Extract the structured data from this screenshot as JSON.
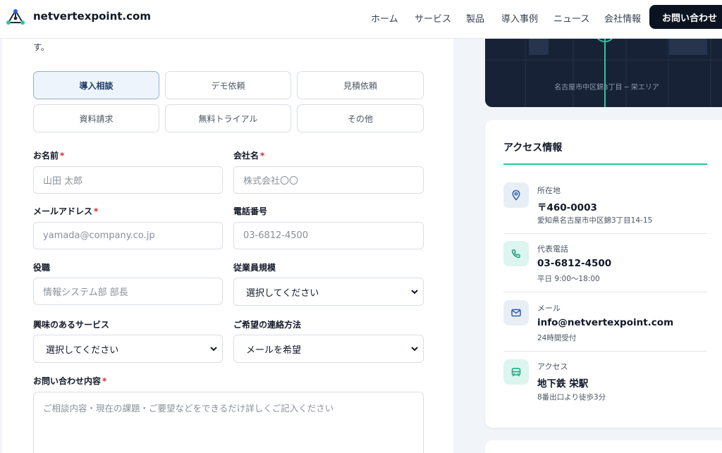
{
  "header": {
    "brand": "netvertexpoint.com",
    "nav": [
      {
        "label": "ホーム"
      },
      {
        "label": "サービス"
      },
      {
        "label": "製品"
      },
      {
        "label": "導入事例"
      },
      {
        "label": "ニュース"
      },
      {
        "label": "会社情報"
      }
    ],
    "cta": "お問い合わせ"
  },
  "form": {
    "lead_tail": "す。",
    "types": [
      "導入相談",
      "デモ依頼",
      "見積依頼",
      "資料請求",
      "無料トライアル",
      "その他"
    ],
    "active_type": "導入相談",
    "name": {
      "label": "お名前",
      "placeholder": "山田 太郎"
    },
    "company": {
      "label": "会社名",
      "placeholder": "株式会社〇〇"
    },
    "email": {
      "label": "メールアドレス",
      "placeholder": "yamada@company.co.jp"
    },
    "phone": {
      "label": "電話番号",
      "placeholder": "03-6812-4500"
    },
    "title": {
      "label": "役職",
      "placeholder": "情報システム部 部長"
    },
    "employees": {
      "label": "従業員規模",
      "value": "選択してください"
    },
    "service": {
      "label": "興味のあるサービス",
      "value": "選択してください"
    },
    "contact_method": {
      "label": "ご希望の連絡方法",
      "value": "メールを希望"
    },
    "message": {
      "label": "お問い合わせ内容",
      "placeholder": "ご相談内容・現在の課題・ご要望などをできるだけ詳しくご記入ください"
    },
    "required_mark": "*"
  },
  "map": {
    "caption": "名古屋市中区錦3丁目 ─ 栄エリア"
  },
  "access": {
    "title": "アクセス情報",
    "items": [
      {
        "icon": "map-pin-icon",
        "label": "所在地",
        "value": "〒460-0003",
        "sub": "愛知県名古屋市中区錦3丁目14-15"
      },
      {
        "icon": "phone-icon",
        "label": "代表電話",
        "value": "03-6812-4500",
        "sub": "平日 9:00〜18:00"
      },
      {
        "icon": "mail-icon",
        "label": "メール",
        "value": "info@netvertexpoint.com",
        "sub": "24時間受付"
      },
      {
        "icon": "train-icon",
        "label": "アクセス",
        "value": "地下鉄 栄駅",
        "sub": "8番出口より徒歩3分"
      }
    ]
  },
  "colors": {
    "accent": "#2bc4a0",
    "dark": "#0b1220",
    "map_bg": "#172236",
    "required": "#dc2626"
  }
}
